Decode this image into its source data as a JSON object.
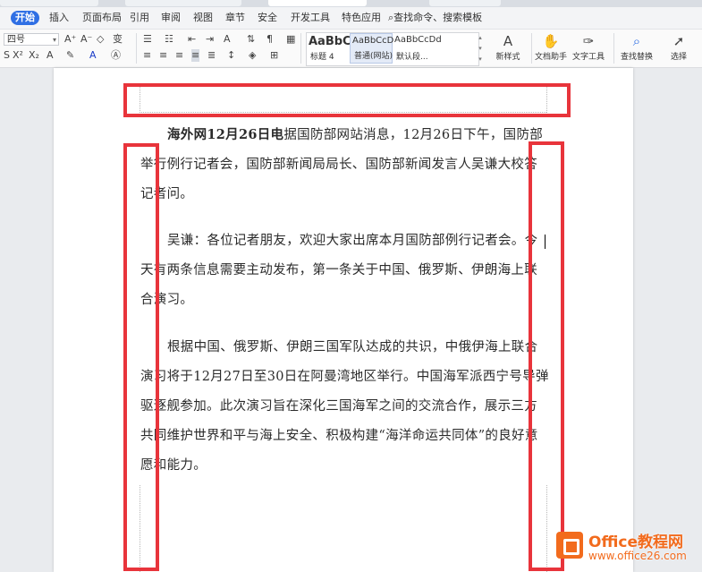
{
  "menu": {
    "start": "开始",
    "items": [
      "插入",
      "页面布局",
      "引用",
      "审阅",
      "视图",
      "章节",
      "安全",
      "开发工具",
      "特色应用"
    ],
    "search": "查找命令、搜索模板"
  },
  "ribbon": {
    "font_size": "四号",
    "styles": [
      {
        "preview": "AaBbC",
        "name": "标题 4"
      },
      {
        "preview": "AaBbCcD",
        "name": "普通(网站)"
      },
      {
        "preview": "AaBbCcDd",
        "name": "默认段..."
      }
    ],
    "new_style": "新样式",
    "doc_assistant": "文档助手",
    "text_tools": "文字工具",
    "find_replace": "查找替换",
    "select": "选择"
  },
  "document": {
    "p1_lead": "海外网12月26日电",
    "p1_rest": "据国防部网站消息，12月26日下午，国防部举行例行记者会，国防部新闻局局长、国防部新闻发言人吴谦大校答记者问。",
    "p2": "吴谦：各位记者朋友，欢迎大家出席本月国防部例行记者会。今天有两条信息需要主动发布，第一条关于中国、俄罗斯、伊朗海上联合演习。",
    "p3": "根据中国、俄罗斯、伊朗三国军队达成的共识，中俄伊海上联合演习将于12月27日至30日在阿曼湾地区举行。中国海军派西宁号导弹驱逐舰参加。此次演习旨在深化三国海军之间的交流合作，展示三方共同维护世界和平与海上安全、积极构建“海洋命运共同体”的良好意愿和能力。"
  },
  "watermark": {
    "title": "Office教程网",
    "url": "www.office26.com"
  }
}
